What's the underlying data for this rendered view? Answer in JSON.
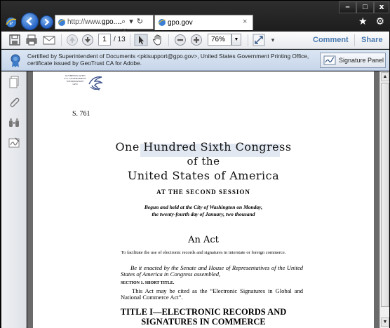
{
  "browser": {
    "address_url_prefix": "http://www.",
    "address_url_host": "gpo....",
    "address_tools": "⌕ ▾ ↻ ✕",
    "tab_title": "gpo.gov",
    "tab_close": "×",
    "window_min": "–",
    "window_max": "□",
    "window_close": "x",
    "top_right_icons": "★ ⚙"
  },
  "toolbar": {
    "current_page": "1",
    "page_total": "/ 13",
    "zoom": "76%",
    "zoom_dropdown": "▼",
    "overflow": "▾",
    "comment_label": "Comment",
    "share_label": "Share"
  },
  "certificate": {
    "text": "Certified by Superintendent of Documents <pkisupport@gpo.gov>, United States Government Printing Office, certificate issued by GeoTrust CA for Adobe.",
    "button_label": "Signature Panel"
  },
  "scrollbar": {
    "up": "▲",
    "down": "▼"
  },
  "document": {
    "seal_text": "AUTHENTICATED\nU.S. GOVERNMENT\nINFORMATION\nGPO",
    "bill_number": "S. 761",
    "heading_line1": "One Hundred Sixth Congress",
    "heading_line2": "of the",
    "heading_line3": "United States of America",
    "session": "AT THE SECOND SESSION",
    "begun_line1": "Begun and held at the City of Washington on Monday,",
    "begun_line2": "the twenty-fourth day of January, two thousand",
    "act_heading": "An Act",
    "purpose": "To facilitate the use of electronic records and signatures in interstate or foreign commerce.",
    "enacting_clause": "Be it enacted by the Senate and House of Representatives of the United States of America in Congress assembled,",
    "section_heading": "SECTION 1. SHORT TITLE.",
    "section_text": "This Act may be cited as the “Electronic Signatures in Global and National Commerce Act”.",
    "title_line1": "TITLE I—ELECTRONIC RECORDS AND",
    "title_line2": "SIGNATURES IN COMMERCE"
  },
  "icons": {
    "ie": "ie-logo-icon",
    "back": "back-arrow-icon",
    "forward": "forward-arrow-icon",
    "site": "gpo-site-icon",
    "save": "save-icon",
    "print": "print-icon",
    "email": "email-icon",
    "prev_page": "previous-page-icon",
    "next_page": "next-page-icon",
    "select": "select-tool-icon",
    "hand": "hand-tool-icon",
    "zoom_out": "zoom-out-icon",
    "zoom_in": "zoom-in-icon",
    "fit": "fit-page-icon",
    "certificate": "certificate-ribbon-icon",
    "signature": "signature-pen-icon",
    "pages": "pages-panel-icon",
    "attachments": "attachments-paperclip-icon",
    "find": "binoculars-icon",
    "signatures": "signatures-panel-icon"
  }
}
